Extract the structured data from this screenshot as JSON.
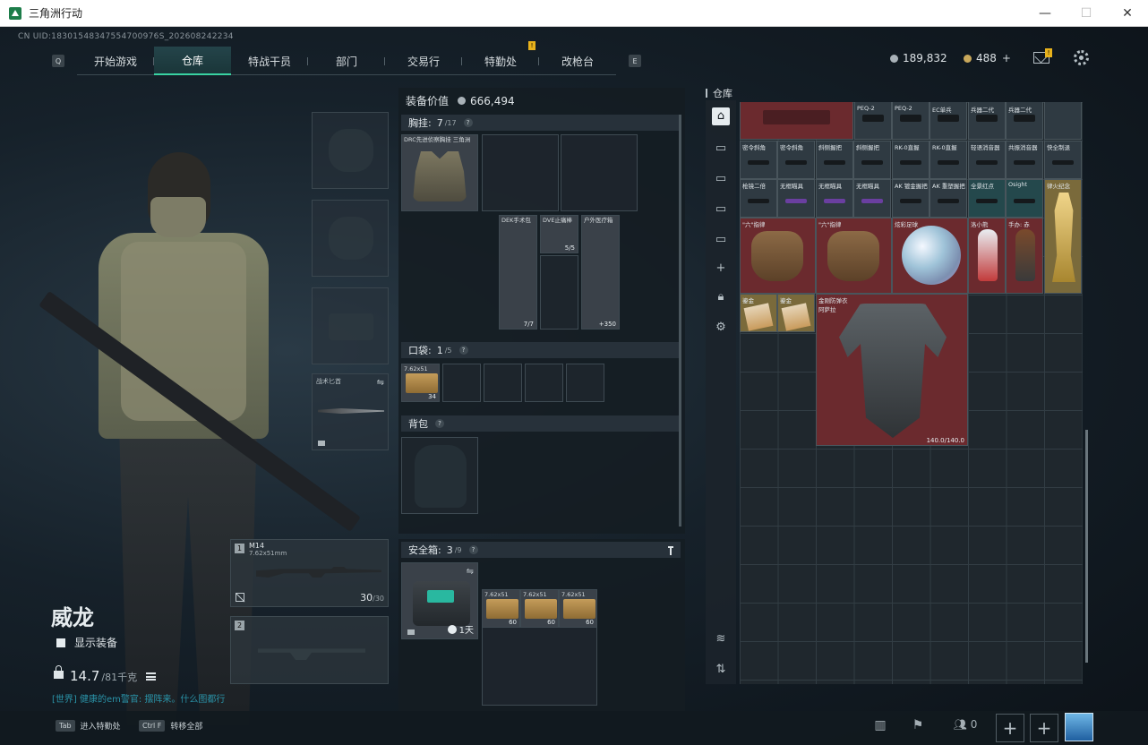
{
  "window": {
    "title": "三角洲行动",
    "minimize": "—",
    "maximize": "☐",
    "close": "✕"
  },
  "uid": "CN UID:18301548347554700976S_202608242234",
  "nav": {
    "left_key": "Q",
    "right_key": "E",
    "tabs": [
      {
        "label": "开始游戏",
        "active": false,
        "badge": ""
      },
      {
        "label": "仓库",
        "active": true,
        "badge": ""
      },
      {
        "label": "特战干员",
        "active": false,
        "badge": ""
      },
      {
        "label": "部门",
        "active": false,
        "badge": ""
      },
      {
        "label": "交易行",
        "active": false,
        "badge": ""
      },
      {
        "label": "特勤处",
        "active": false,
        "badge": "!"
      },
      {
        "label": "改枪台",
        "active": false,
        "badge": ""
      }
    ]
  },
  "currency": {
    "silver": "189,832",
    "gold": "488",
    "gold_plus": "+",
    "mail_badge": "!"
  },
  "operator": {
    "name": "威龙",
    "show_gear_label": "显示装备",
    "weight": "14.7",
    "weight_max": "/81千克",
    "chat": "[世界] 健康的em警官: 摆阵来。什么图都行"
  },
  "slots": {
    "knife_label": "战术匕首",
    "swap_glyph": "⇋",
    "weapon1": {
      "num": "1",
      "name": "M14",
      "caliber": "7.62x51mm",
      "ammo": "30",
      "ammo_max": "/30"
    },
    "weapon2": {
      "num": "2"
    }
  },
  "equipment": {
    "value_label": "装备价值",
    "value": "666,494",
    "chest": {
      "label": "胸挂:",
      "count": "7",
      "cap": "/17",
      "help": "?"
    },
    "chest_item_label": "DRC先进侦察胸挂 三角洲",
    "chest_items": [
      {
        "label": "DEK手术包",
        "count": "7/7"
      },
      {
        "label": "DVE止痛棒",
        "count": "5/5"
      },
      {
        "label": "户外医疗箱",
        "count": "+350"
      }
    ],
    "pocket": {
      "label": "口袋:",
      "count": "1",
      "cap": "/5",
      "help": "?"
    },
    "pocket_item": {
      "label": "7.62x51",
      "count": "34"
    },
    "backpack": {
      "label": "背包",
      "help": "?"
    },
    "safebox": {
      "label": "安全箱:",
      "count": "3",
      "cap": "/9",
      "help": "?",
      "timer": "1天"
    },
    "safebox_items": [
      {
        "label": "7.62x51",
        "count": "60"
      },
      {
        "label": "7.62x51",
        "count": "60"
      },
      {
        "label": "7.62x51",
        "count": "60"
      }
    ]
  },
  "warehouse": {
    "label": "仓库",
    "row1": [
      "PEQ-2",
      "PEQ-2",
      "EC单兵",
      "兵器二代",
      "兵器二代"
    ],
    "row2": [
      "密令斜角",
      "密令斜角",
      "斜侧握把",
      "斜侧握把",
      "RK-0直握",
      "RK-0直握",
      "轻语消音器",
      "共振消音器",
      "快全制退"
    ],
    "row3": [
      "枪镜二倍",
      "无框瞄具",
      "无框瞄具",
      "无框瞄具",
      "AK 镀金握把",
      "AK 重塑握把",
      "全景红点",
      "Osight",
      "律火纪念"
    ],
    "row4": [
      "\"六\"指律",
      "\"六\"指律",
      "炫彩足球",
      "洛小熊",
      "手办: 赤"
    ],
    "row5": [
      "鎏金",
      "鎏金",
      "金刚防弹衣 阿萨拉"
    ],
    "armor_durability": "140.0/140.0"
  },
  "bottom": {
    "hint1_key": "Tab",
    "hint1_label": "进入特勤处",
    "hint2_key": "Ctrl F",
    "hint2_label": "转移全部",
    "team_count": "0",
    "plus": "+"
  }
}
